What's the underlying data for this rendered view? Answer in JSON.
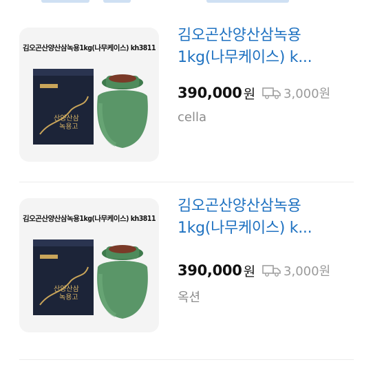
{
  "products": [
    {
      "image_caption": "김오곤산양산삼녹용1kg(나무케이스) kh3811",
      "box_label": "산양산삼 녹용고",
      "title_line1": "김오곤산양산삼녹용",
      "title_line2": "1kg(나무케이스) k...",
      "price": "390,000",
      "currency": "원",
      "shipping": "3,000원",
      "seller": "cella",
      "truck_icon": "truck-icon"
    },
    {
      "image_caption": "김오곤산양산삼녹용1kg(나무케이스) kh3811",
      "box_label": "산양산삼 녹용고",
      "title_line1": "김오곤산양산삼녹용",
      "title_line2": "1kg(나무케이스) k...",
      "price": "390,000",
      "currency": "원",
      "shipping": "3,000원",
      "seller": "옥션",
      "truck_icon": "truck-icon"
    }
  ],
  "colors": {
    "title": "#1f72c1",
    "price": "#111111",
    "muted": "#8c8c8c",
    "jar": "#4e8b5c",
    "box": "#1c2438"
  }
}
